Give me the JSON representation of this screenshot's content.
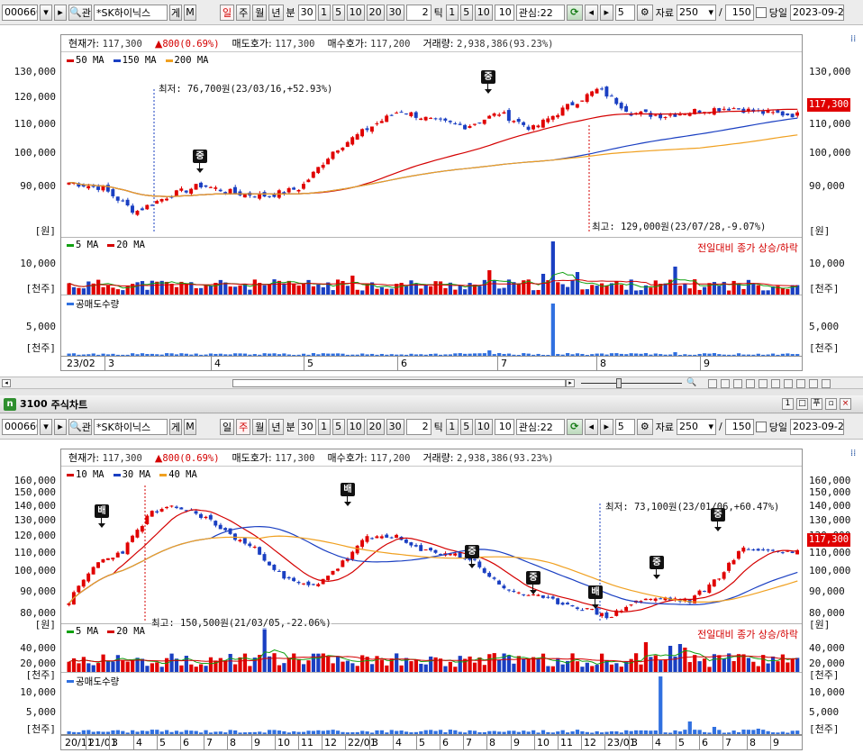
{
  "top": {
    "toolbar": {
      "code": "000660",
      "search_label": "관",
      "name": "*SK하이닉스",
      "gi": "게",
      "m": "M",
      "periods": [
        "일",
        "주",
        "월",
        "년",
        "분"
      ],
      "active_period": "일",
      "min_sel": "30",
      "nums": [
        "1",
        "5",
        "10",
        "20",
        "30"
      ],
      "tick_val": "2",
      "tick_lbl": "틱",
      "ticks": [
        "1",
        "5",
        "10"
      ],
      "tick_sel": "10",
      "interest": "관심:22",
      "step": "5",
      "data_lbl": "자료",
      "count": "250",
      "slash": "/",
      "total": "150",
      "today_lbl": "당일",
      "date": "2023-09-2"
    },
    "info": {
      "cur_lbl": "현재가:",
      "cur_val": "117,300",
      "chg": "800(0.69%)",
      "ask_lbl": "매도호가:",
      "ask_val": "117,300",
      "bid_lbl": "매수호가:",
      "bid_val": "117,200",
      "vol_lbl": "거래량:",
      "vol_val": "2,938,386(93.23%)"
    },
    "legend": [
      {
        "name": "50 MA",
        "color": "#d40000"
      },
      {
        "name": "150 MA",
        "color": "#1a3fc2"
      },
      {
        "name": "200 MA",
        "color": "#f0a020"
      }
    ],
    "yaxis": [
      "130,000",
      "120,000",
      "110,000",
      "100,000",
      "90,000"
    ],
    "yunit": "[원]",
    "price_tag": "117,300",
    "low_note": "최저: 76,700원(23/03/16,+52.93%)",
    "high_note": "최고: 129,000원(23/07/28,-9.07%)",
    "marks": [
      "중",
      "중"
    ],
    "vol": {
      "legend": [
        {
          "name": "5 MA",
          "color": "#10a010"
        },
        {
          "name": "20 MA",
          "color": "#d40000"
        }
      ],
      "right": "전일대비 종가 상승/하락",
      "axis": "10,000",
      "unit": "[천주]"
    },
    "short": {
      "legend": "공매도수량",
      "axis": "5,000",
      "unit": "[천주]"
    },
    "dates": [
      "23/02",
      "3",
      "4",
      "5",
      "6",
      "7",
      "8",
      "9"
    ]
  },
  "window": {
    "code": "3100",
    "title": "주식차트",
    "buttons": [
      "1",
      "□",
      "푸",
      "▫",
      "×"
    ]
  },
  "bottom": {
    "toolbar": {
      "code": "000660",
      "search_label": "관",
      "name": "*SK하이닉스",
      "gi": "게",
      "m": "M",
      "periods": [
        "일",
        "주",
        "월",
        "년",
        "분"
      ],
      "active_period": "주",
      "min_sel": "30",
      "nums": [
        "1",
        "5",
        "10",
        "20",
        "30"
      ],
      "tick_val": "2",
      "tick_lbl": "틱",
      "ticks": [
        "1",
        "5",
        "10"
      ],
      "tick_sel": "10",
      "interest": "관심:22",
      "step": "5",
      "data_lbl": "자료",
      "count": "250",
      "slash": "/",
      "total": "150",
      "today_lbl": "당일",
      "date": "2023-09-2"
    },
    "info": {
      "cur_lbl": "현재가:",
      "cur_val": "117,300",
      "chg": "800(0.69%)",
      "ask_lbl": "매도호가:",
      "ask_val": "117,300",
      "bid_lbl": "매수호가:",
      "bid_val": "117,200",
      "vol_lbl": "거래량:",
      "vol_val": "2,938,386(93.23%)"
    },
    "legend": [
      {
        "name": "10 MA",
        "color": "#d40000"
      },
      {
        "name": "30 MA",
        "color": "#1a3fc2"
      },
      {
        "name": "40 MA",
        "color": "#f0a020"
      }
    ],
    "yaxis": [
      "160,000",
      "150,000",
      "140,000",
      "130,000",
      "120,000",
      "110,000",
      "100,000",
      "90,000",
      "80,000"
    ],
    "yunit": "[원]",
    "price_tag": "117,300",
    "low_note": "최저: 73,100원(23/01/06,+60.47%)",
    "high_note": "최고: 150,500원(21/03/05,-22.06%)",
    "marks": [
      "배",
      "배",
      "중",
      "중",
      "배",
      "중",
      "중"
    ],
    "vol": {
      "legend": [
        {
          "name": "5 MA",
          "color": "#10a010"
        },
        {
          "name": "20 MA",
          "color": "#d40000"
        }
      ],
      "right": "전일대비 종가 상승/하락",
      "axis": [
        "40,000",
        "20,000"
      ],
      "unit": "[천주]"
    },
    "short": {
      "legend": "공매도수량",
      "axis": [
        "10,000",
        "5,000"
      ],
      "unit": "[천주]"
    },
    "dates": [
      "20/11",
      "21/01",
      "3",
      "4",
      "5",
      "6",
      "7",
      "8",
      "9",
      "10",
      "11",
      "12",
      "22/01",
      "3",
      "4",
      "5",
      "6",
      "7",
      "8",
      "9",
      "10",
      "11",
      "12",
      "23/01",
      "3",
      "4",
      "5",
      "6",
      "7",
      "8",
      "9"
    ]
  }
}
